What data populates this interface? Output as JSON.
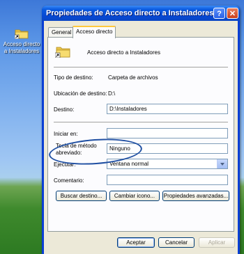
{
  "desktop": {
    "icon_label": "Acceso directo a Instaladores"
  },
  "window": {
    "title": "Propiedades de Acceso directo a Instaladores",
    "help_glyph": "?",
    "close_glyph": "✕"
  },
  "tabs": [
    {
      "label": "General",
      "active": false
    },
    {
      "label": "Acceso directo",
      "active": true
    }
  ],
  "shortcut": {
    "name": "Acceso directo a Instaladores",
    "target_type_label": "Tipo de destino:",
    "target_type_value": "Carpeta de archivos",
    "target_location_label": "Ubicación de destino:",
    "target_location_value": "D:\\",
    "target_label": "Destino:",
    "target_value": "D:\\Instaladores",
    "start_in_label": "Iniciar en:",
    "start_in_value": "",
    "hotkey_label": "Tecla de método abreviado:",
    "hotkey_value": "Ninguno",
    "run_label": "Ejecutar:",
    "run_value": "Ventana normal",
    "comment_label": "Comentario:",
    "comment_value": ""
  },
  "actions": {
    "find_target": "Buscar destino...",
    "change_icon": "Cambiar icono...",
    "advanced": "Propiedades avanzadas..."
  },
  "footer": {
    "ok": "Aceptar",
    "cancel": "Cancelar",
    "apply": "Aplicar"
  },
  "colors": {
    "titlebar": "#0a5ae0",
    "dialog_bg": "#ece9d8",
    "annotation_oval": "#1f4fa2"
  }
}
